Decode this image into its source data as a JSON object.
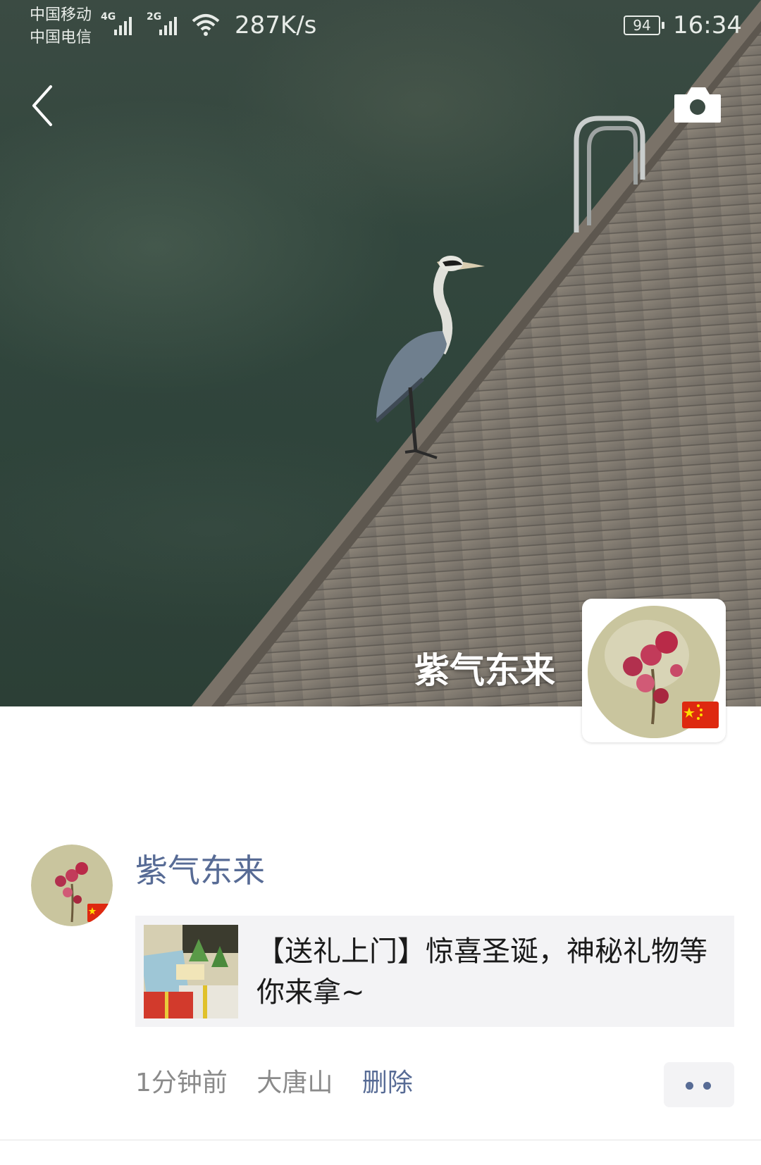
{
  "status_bar": {
    "carrier_1": "中国移动",
    "carrier_2": "中国电信",
    "net_1": "4G",
    "net_2": "2G",
    "speed": "287K/s",
    "battery": "94",
    "time": "16:34"
  },
  "header": {
    "back_icon": "chevron-left-icon",
    "camera_icon": "camera-icon"
  },
  "cover": {
    "display_name": "紫气东来"
  },
  "post": {
    "author": "紫气东来",
    "link_title": "【送礼上门】惊喜圣诞，神秘礼物等你来拿~",
    "time_ago": "1分钟前",
    "location": "大唐山",
    "delete_label": "删除"
  },
  "colors": {
    "link_blue": "#576b95",
    "card_bg": "#f3f3f5",
    "meta_gray": "#8a8a8a"
  }
}
